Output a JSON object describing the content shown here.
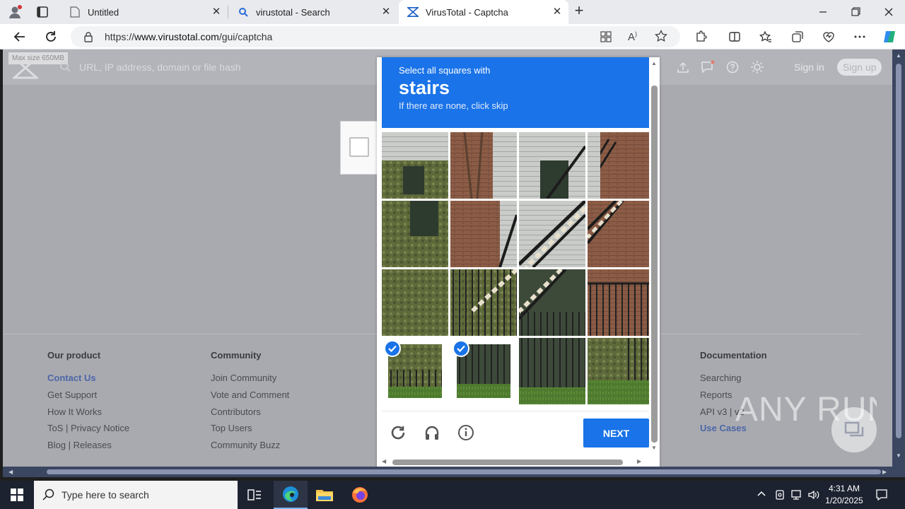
{
  "browser": {
    "tabs": [
      {
        "title": "Untitled"
      },
      {
        "title": "virustotal - Search"
      },
      {
        "title": "VirusTotal - Captcha"
      }
    ],
    "url_prefix": "https://",
    "url_domain": "www.virustotal.com",
    "url_path": "/gui/captcha"
  },
  "virustotal": {
    "max_size": "Max size 650MB",
    "search_placeholder": "URL, IP address, domain or file hash",
    "sign_in": "Sign in",
    "sign_up": "Sign up",
    "footer": {
      "columns": [
        {
          "title": "Our product",
          "links": [
            "Contact Us",
            "Get Support",
            "How It Works",
            "ToS | Privacy Notice",
            "Blog | Releases"
          ]
        },
        {
          "title": "Community",
          "links": [
            "Join Community",
            "Vote and Comment",
            "Contributors",
            "Top Users",
            "Community Buzz"
          ]
        },
        {
          "title": "Documentation",
          "links": [
            "Searching",
            "Reports",
            "API v3 | v2",
            "Use Cases"
          ]
        }
      ]
    }
  },
  "captcha": {
    "instruction": "Select all squares with",
    "target_word": "stairs",
    "hint": "If there are none, click skip",
    "next_label": "NEXT",
    "selected_cells": [
      12,
      13
    ]
  },
  "watermark": "ANY RUN",
  "taskbar": {
    "search_placeholder": "Type here to search",
    "time": "4:31 AM",
    "date": "1/20/2025"
  },
  "colors": {
    "captcha_blue": "#1a73e8",
    "page_overlay": "#a9aab0",
    "accent_link": "#4d66a8"
  }
}
